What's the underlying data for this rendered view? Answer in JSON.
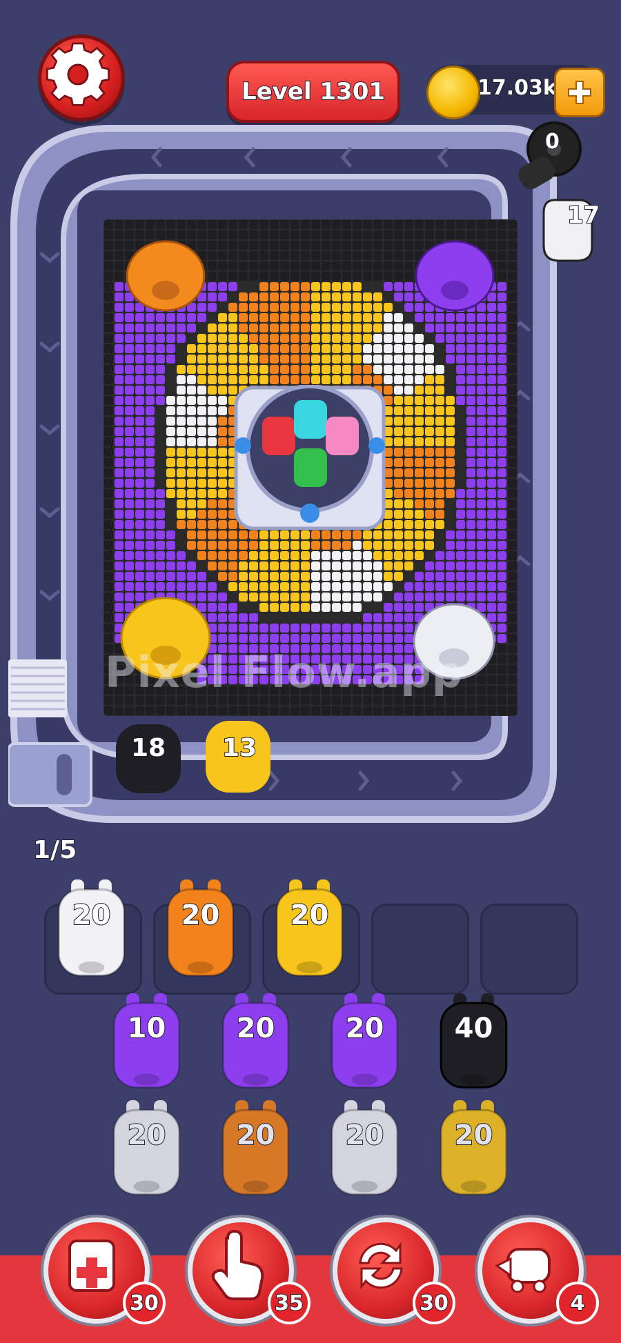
{
  "header": {
    "level_label": "Level 1301",
    "coins": "17.03k"
  },
  "launcher": {
    "top_counter": "0",
    "side_counter": "17"
  },
  "board": {
    "watermark": "Pixel Flow.app"
  },
  "track": {
    "queue_pigs": [
      {
        "color": "#1e1e24",
        "count": "18"
      },
      {
        "color": "#f7c21c",
        "count": "13"
      }
    ],
    "queue_progress": "1/5"
  },
  "tray": {
    "slots": [
      {
        "color": "#f2f2f5",
        "count": "20"
      },
      {
        "color": "#f2821c",
        "count": "20"
      },
      {
        "color": "#f8c51c",
        "count": "20"
      },
      {
        "color": null,
        "count": ""
      },
      {
        "color": null,
        "count": ""
      }
    ]
  },
  "grid": {
    "rows": [
      [
        {
          "color": "#8d3ff0",
          "count": "10"
        },
        {
          "color": "#8d3ff0",
          "count": "20"
        },
        {
          "color": "#8d3ff0",
          "count": "20"
        },
        {
          "color": "#1e1e24",
          "count": "40"
        }
      ],
      [
        {
          "color": "#eeeef2",
          "count": "20"
        },
        {
          "color": "#f2821c",
          "count": "20"
        },
        {
          "color": "#eeeef2",
          "count": "20"
        },
        {
          "color": "#f8c51c",
          "count": "20"
        }
      ]
    ]
  },
  "powerups": [
    {
      "icon": "add-slot-icon",
      "count": "30"
    },
    {
      "icon": "hand-pointer-icon",
      "count": "35"
    },
    {
      "icon": "shuffle-icon",
      "count": "30"
    },
    {
      "icon": "pig-train-icon",
      "count": "4"
    }
  ],
  "colors": {
    "purple": "#8d3ff0",
    "orange": "#f2821c",
    "yellow": "#f8c51c",
    "white": "#f2f2f5",
    "black": "#1e1e24",
    "red_accent": "#e2383d"
  }
}
